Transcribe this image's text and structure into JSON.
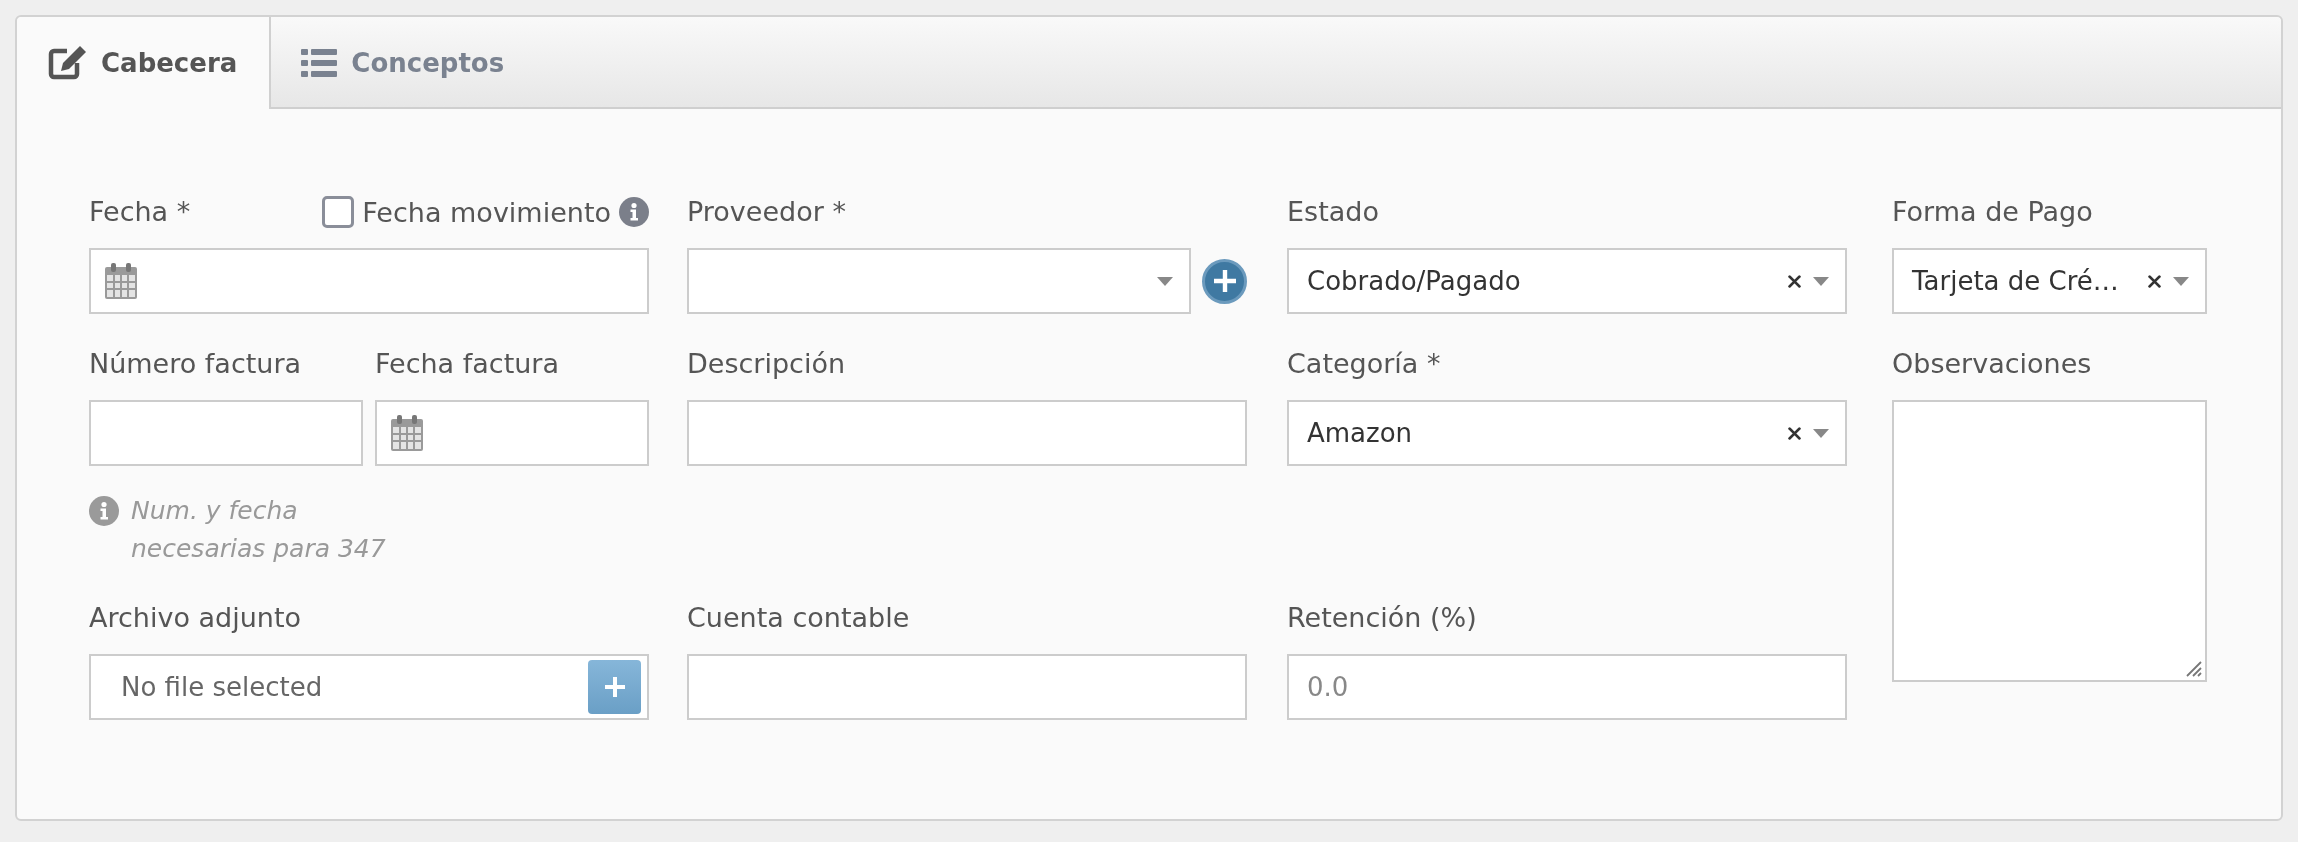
{
  "tabs": [
    {
      "label": "Cabecera",
      "selected": true
    },
    {
      "label": "Conceptos",
      "selected": false
    }
  ],
  "fields": [
    {
      "kind": "date",
      "label": "Fecha *",
      "option": {
        "label": "Fecha movimiento",
        "checked": false
      }
    },
    {
      "kind": "lookup",
      "label": "Proveedor *"
    },
    {
      "kind": "select",
      "label": "Estado",
      "value": "Cobrado/Pagado",
      "clearable": true
    },
    {
      "kind": "select",
      "label": "Forma de Pago",
      "value": "Tarjeta de Cré…",
      "clearable": true
    },
    {
      "kind": "text",
      "label": "Número factura"
    },
    {
      "kind": "date",
      "label": "Fecha factura"
    },
    {
      "kind": "text",
      "label": "Descripción"
    },
    {
      "kind": "select",
      "label": "Categoría *",
      "value": "Amazon",
      "clearable": true
    },
    {
      "kind": "textarea",
      "label": "Observaciones"
    },
    {
      "kind": "help",
      "text": "Num. y fecha necesarias para 347"
    },
    {
      "kind": "file",
      "label": "Archivo adjunto",
      "status": "No file selected"
    },
    {
      "kind": "text",
      "label": "Cuenta contable"
    },
    {
      "kind": "text",
      "label": "Retención (%)",
      "placeholder": "0.0"
    }
  ]
}
